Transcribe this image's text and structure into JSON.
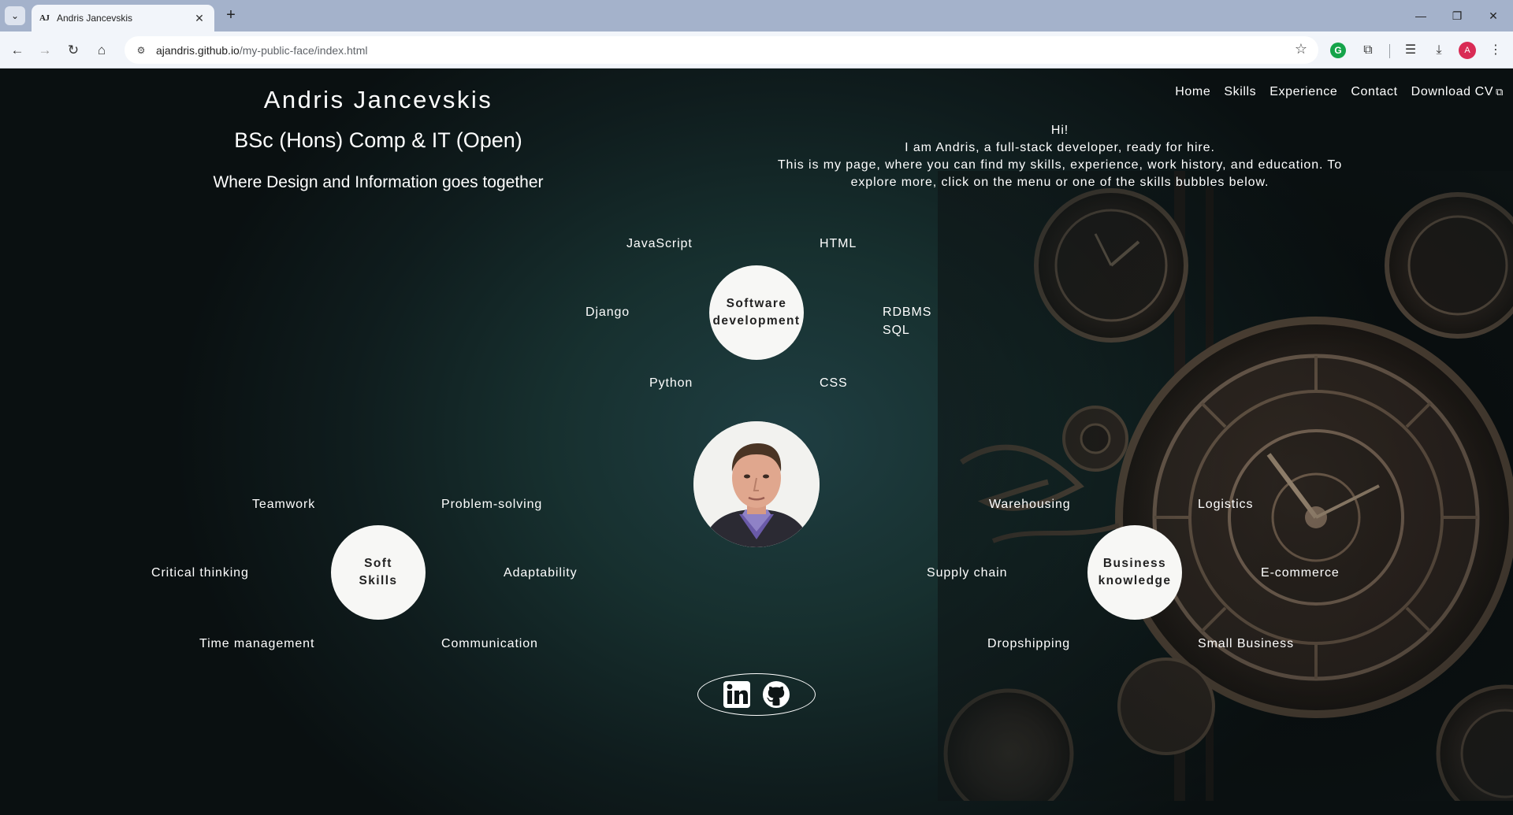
{
  "browser": {
    "tab_title": "Andris Jancevskis",
    "tab_favicon": "AJ",
    "url_host": "ajandris.github.io",
    "url_path": "/my-public-face/index.html",
    "profile_initial": "A"
  },
  "header": {
    "name": "Andris Jancevskis",
    "degree": "BSc (Hons) Comp & IT (Open)",
    "tagline": "Where Design and Information goes together"
  },
  "nav": {
    "items": [
      "Home",
      "Skills",
      "Experience",
      "Contact",
      "Download CV"
    ]
  },
  "intro": {
    "greeting": "Hi!",
    "line1": "I am Andris, a full-stack developer, ready for hire.",
    "line2": "This is my page, where you can find my skills, experience, work history, and education. To explore more, click on the menu or one of the skills bubbles below."
  },
  "software": {
    "bubble_line1": "Software",
    "bubble_line2": "development",
    "skills": [
      "JavaScript",
      "HTML",
      "Django",
      "RDBMS",
      "SQL",
      "Python",
      "CSS"
    ]
  },
  "soft": {
    "bubble_line1": "Soft",
    "bubble_line2": "Skills",
    "skills": [
      "Teamwork",
      "Problem-solving",
      "Critical thinking",
      "Adaptability",
      "Time management",
      "Communication"
    ]
  },
  "business": {
    "bubble_line1": "Business",
    "bubble_line2": "knowledge",
    "skills": [
      "Warehousing",
      "Logistics",
      "Supply chain",
      "E-commerce",
      "Dropshipping",
      "Small Business"
    ]
  },
  "social": {
    "icons": [
      "linkedin-icon",
      "github-icon"
    ]
  }
}
